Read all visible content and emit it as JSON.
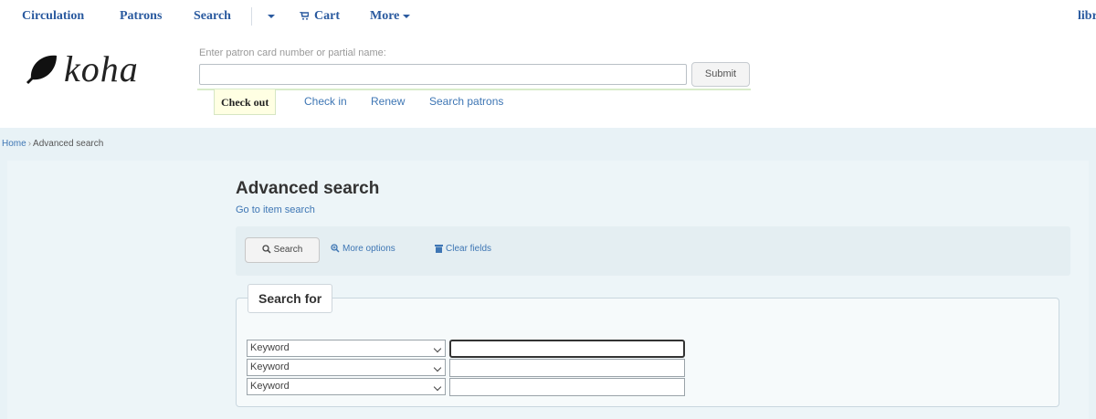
{
  "nav": {
    "circulation": "Circulation",
    "patrons": "Patrons",
    "search": "Search",
    "cart": "Cart",
    "more": "More",
    "library": "libr"
  },
  "header": {
    "logo_text": "koha",
    "search_hint": "Enter patron card number or partial name:",
    "patron_input_value": "",
    "submit_label": "Submit",
    "tabs": [
      "Check out",
      "Check in",
      "Renew",
      "Search patrons"
    ]
  },
  "breadcrumb": {
    "home": "Home",
    "separator": "›",
    "current": "Advanced search"
  },
  "page": {
    "title": "Advanced search",
    "item_search_link": "Go to item search",
    "toolbar": {
      "search": "Search",
      "more_options": "More options",
      "clear_fields": "Clear fields"
    },
    "search_for": {
      "legend": "Search for",
      "rows": [
        {
          "index": "Keyword",
          "value": ""
        },
        {
          "index": "Keyword",
          "value": ""
        },
        {
          "index": "Keyword",
          "value": ""
        }
      ]
    }
  },
  "colors": {
    "link": "#3e76b4",
    "page_bg": "#e8f2f6",
    "active_tab_bg": "#ffffe3"
  }
}
